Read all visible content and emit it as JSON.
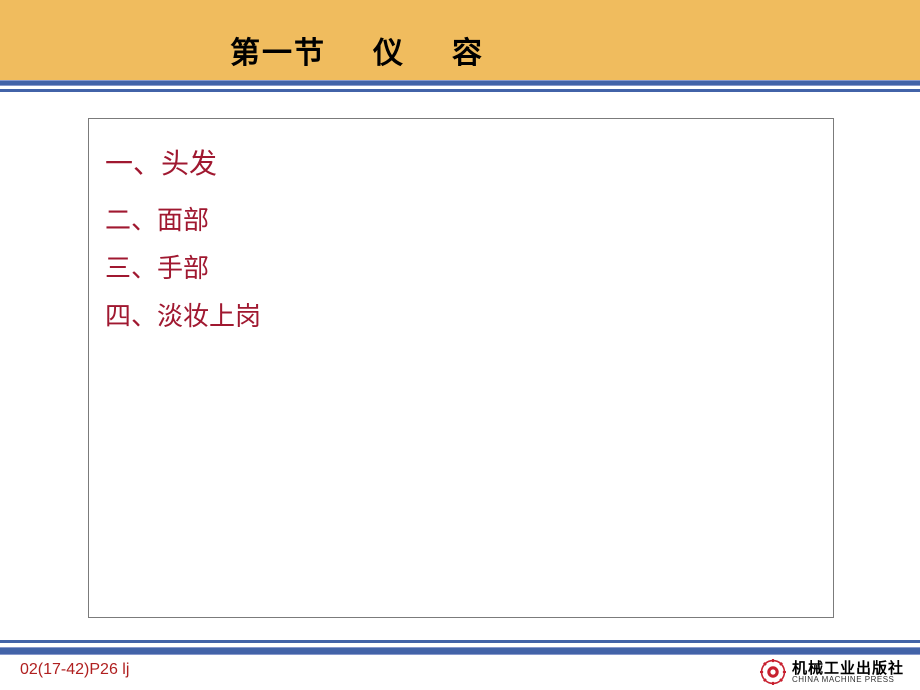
{
  "header": {
    "title_part1": "第一节",
    "title_part2": "仪",
    "title_part3": "容"
  },
  "content": {
    "items": [
      "一、头发",
      "二、面部",
      "三、手部",
      "四、淡妆上岗"
    ]
  },
  "footer": {
    "code": "02(17-42)P26 lj",
    "publisher_cn": "机械工业出版社",
    "publisher_en": "CHINA MACHINE PRESS"
  },
  "colors": {
    "header_bg": "#f0bc5e",
    "line_blue": "#4263a8",
    "text_red": "#a01830",
    "footer_code": "#b02020",
    "gear_red": "#c8202f"
  }
}
